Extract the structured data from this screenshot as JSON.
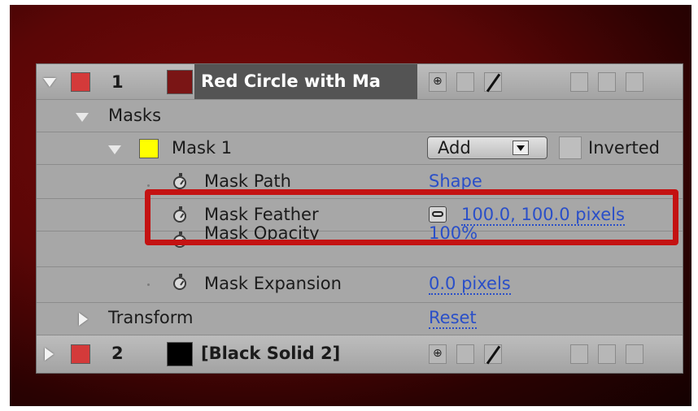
{
  "layers": [
    {
      "number": "1",
      "name": "Red Circle with Ma",
      "label_color": "#d43a3a",
      "solid_color": "#7a1515"
    },
    {
      "number": "2",
      "name": "[Black Solid 2]",
      "label_color": "#d43a3a",
      "solid_color": "#000000"
    }
  ],
  "masks_group": {
    "label": "Masks"
  },
  "mask1": {
    "name": "Mask 1",
    "color": "#ffff00",
    "mode": "Add",
    "inverted_label": "Inverted"
  },
  "properties": [
    {
      "name": "Mask Path",
      "value": "Shape"
    },
    {
      "name": "Mask Feather",
      "value": "100.0, 100.0 pixels"
    },
    {
      "name": "Mask Opacity",
      "value": "100%"
    },
    {
      "name": "Mask Expansion",
      "value": "0.0 pixels"
    }
  ],
  "transform": {
    "label": "Transform",
    "value": "Reset"
  },
  "highlight_color": "#c41212"
}
